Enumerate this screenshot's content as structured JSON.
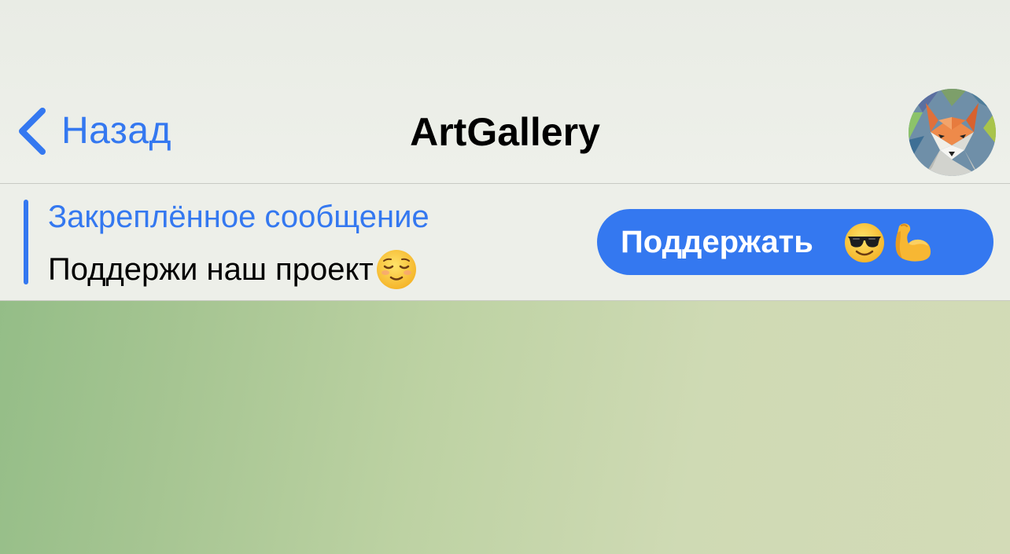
{
  "header": {
    "back_label": "Назад",
    "title": "ArtGallery",
    "avatar_icon": "fox-avatar-icon"
  },
  "pinned": {
    "title": "Закреплённое сообщение",
    "text": "Поддержи наш проект",
    "text_emoji": "relieved-face-emoji",
    "button_label": "Поддержать",
    "button_emojis": [
      "sunglasses-face-emoji",
      "flexed-biceps-emoji"
    ]
  },
  "colors": {
    "accent": "#3478f0",
    "bar_background": "#edefe9",
    "chat_background_start": "#8fbb84",
    "chat_background_end": "#d3dbb7"
  }
}
